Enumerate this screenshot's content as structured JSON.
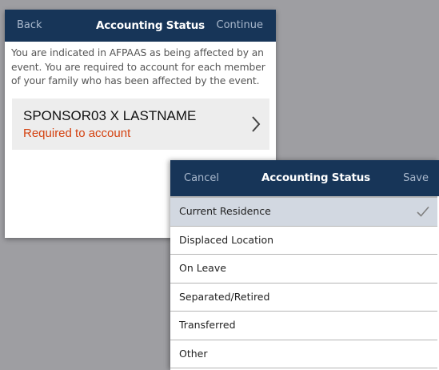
{
  "back_screen": {
    "nav": {
      "left": "Back",
      "title": "Accounting Status",
      "right": "Continue"
    },
    "intro": "You are indicated in AFPAAS as being affected by an event. You are required to account for each member of your family who has been affected by the event.",
    "member": {
      "name": "SPONSOR03 X LASTNAME",
      "status": "Required to account",
      "icon": "chevron-right-icon"
    }
  },
  "front_screen": {
    "nav": {
      "left": "Cancel",
      "title": "Accounting Status",
      "right": "Save"
    },
    "options": [
      "Current Residence",
      "Displaced Location",
      "On Leave",
      "Separated/Retired",
      "Transferred",
      "Other"
    ],
    "selected_option": "Current Residence",
    "selected_icon": "checkmark-icon"
  },
  "colors": {
    "navbar": "#173558",
    "nav_link": "#a9b8cc",
    "status_required": "#d4410f",
    "selected_row": "#d2d8e1",
    "backdrop": "#9e9ea2"
  }
}
